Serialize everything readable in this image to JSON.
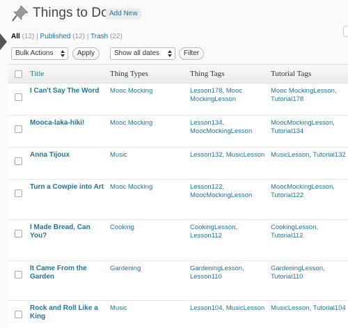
{
  "page": {
    "title": "Things to Do",
    "add_new_label": "Add New"
  },
  "views": {
    "all_label": "All",
    "all_count": "(12)",
    "separator": "|",
    "published_label": "Published",
    "published_count": "(12)",
    "trash_label": "Trash",
    "trash_count": "(22)"
  },
  "toolbar": {
    "bulk_actions": "Bulk Actions",
    "apply_label": "Apply",
    "dates_filter": "Show all dates",
    "filter_label": "Filter"
  },
  "table": {
    "columns": {
      "title": "Title",
      "types": "Thing Types",
      "tags": "Thing Tags",
      "tutorial": "Tutorial Tags"
    },
    "rows": [
      {
        "title": "I Can't Say The Word",
        "types": "Mooc Mocking",
        "tags": "Lesson178, Mooc MockingLesson",
        "tutorial": "Mooc MockingLesson, Tutorial178"
      },
      {
        "title": "Mooca-laka-hiki!",
        "types": "Mooc Mocking",
        "tags": "Lesson134, MoocMockingLesson",
        "tutorial": "MoocMockingLesson, Tutorial134"
      },
      {
        "title": "Anna Tijoux",
        "types": "Music",
        "tags": "Lesson132, MusicLesson",
        "tutorial": "MusicLesson, Tutorial132"
      },
      {
        "title": "Turn a Cowpie into Art",
        "types": "Mooc Mocking",
        "tags": "Lesson122, MoocMockingLesson",
        "tutorial": "MoocMockingLesson, Tutorial122"
      },
      {
        "title": "I Made Bread, Can You?",
        "types": "Cooking",
        "tags": "CookingLesson, Lesson112",
        "tutorial": "CookingLesson, Tutorial112"
      },
      {
        "title": "It Came From the Garden",
        "types": "Gardening",
        "tags": "GardeningLesson, Lesson110",
        "tutorial": "GardeningLesson, Tutorial110"
      },
      {
        "title": "Rock and Roll Like a King",
        "types": "Music",
        "tags": "Lesson104, MusicLesson",
        "tutorial": "MusicLesson, Tutorial104"
      }
    ]
  },
  "icons": {
    "pin": "pushpin-icon",
    "arrow": "menu-collapse-arrow-icon"
  },
  "colors": {
    "link": "#21759b",
    "title_text": "#464646",
    "border": "#dfdfdf"
  }
}
